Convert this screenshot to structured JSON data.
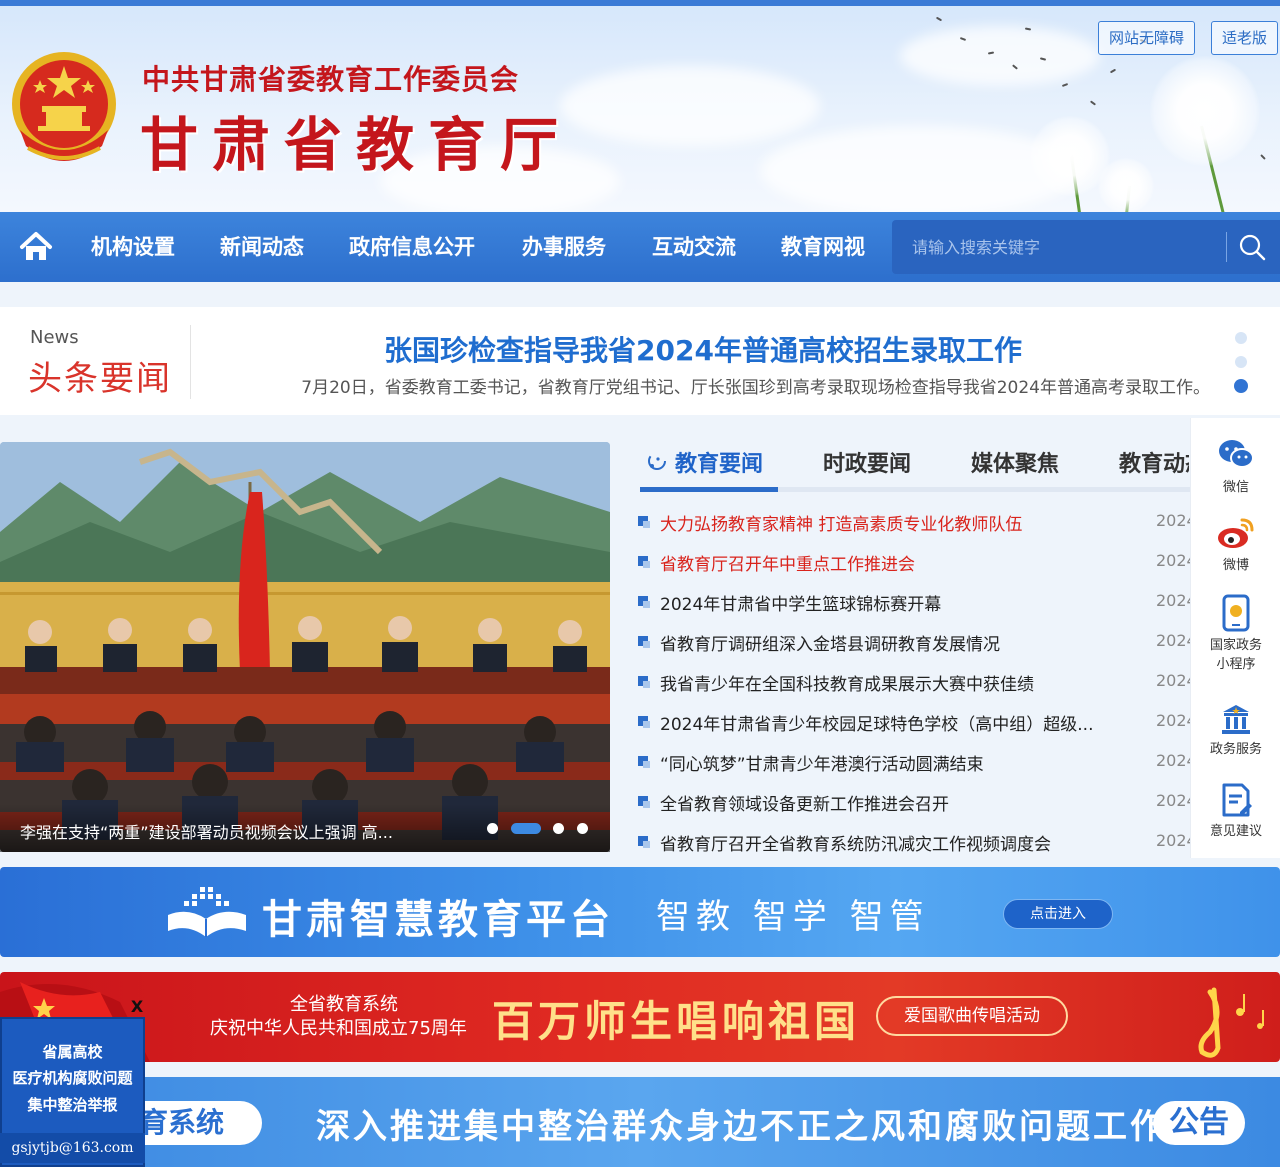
{
  "header": {
    "subtitle": "中共甘肃省委教育工作委员会",
    "title": "甘肃省教育厅",
    "accessibility_label": "网站无障碍",
    "elderly_label": "适老版"
  },
  "nav": {
    "items": [
      "机构设置",
      "新闻动态",
      "政府信息公开",
      "办事服务",
      "互动交流",
      "教育网视"
    ],
    "search_placeholder": "请输入搜索关键字"
  },
  "headline": {
    "label_en": "News",
    "label_cn": "头条要闻",
    "title": "张国珍检查指导我省2024年普通高校招生录取工作",
    "description": "7月20日，省委教育工委书记，省教育厅党组书记、厅长张国珍到高考录取现场检查指导我省2024年普通高考录取工作。"
  },
  "slider": {
    "caption": "李强在支持“两重”建设部署动员视频会议上强调 高..."
  },
  "news": {
    "tabs": [
      "教育要闻",
      "时政要闻",
      "媒体聚焦",
      "教育动态"
    ],
    "items": [
      {
        "title": "大力弘扬教育家精神 打造高素质专业化教师队伍",
        "date": "2024",
        "hot": true
      },
      {
        "title": "省教育厅召开年中重点工作推进会",
        "date": "2024",
        "hot": true
      },
      {
        "title": "2024年甘肃省中学生篮球锦标赛开幕",
        "date": "2024",
        "hot": false
      },
      {
        "title": "省教育厅调研组深入金塔县调研教育发展情况",
        "date": "2024",
        "hot": false
      },
      {
        "title": "我省青少年在全国科技教育成果展示大赛中获佳绩",
        "date": "2024",
        "hot": false
      },
      {
        "title": "2024年甘肃省青少年校园足球特色学校（高中组）超级...",
        "date": "2024",
        "hot": false
      },
      {
        "title": "“同心筑梦”甘肃青少年港澳行活动圆满结束",
        "date": "2024",
        "hot": false
      },
      {
        "title": "全省教育领域设备更新工作推进会召开",
        "date": "2024",
        "hot": false
      },
      {
        "title": "省教育厅召开全省教育系统防汛减灾工作视频调度会",
        "date": "2024",
        "hot": false
      }
    ]
  },
  "side_tools": {
    "wechat": "微信",
    "weibo": "微博",
    "miniapp_1": "国家政务",
    "miniapp_2": "小程序",
    "service": "政务服务",
    "feedback": "意见建议"
  },
  "banner_platform": {
    "title": "甘肃智慧教育平台",
    "sub": "智教 智学 智管",
    "button": "点击进入"
  },
  "banner_song": {
    "line1": "全省教育系统",
    "line2": "庆祝中华人民共和国成立75周年",
    "big": "百万师生唱响祖国",
    "pill": "爱国歌曲传唱活动"
  },
  "banner_anti": {
    "left": "育系统",
    "main": "深入推进集中整治群众身边不正之风和腐败问题工作",
    "tag": "公告"
  },
  "float_widget": {
    "close": "X",
    "line1": "省属高校",
    "line2": "医疗机构腐败问题",
    "line3": "集中整治举报",
    "email": "gsjytjb@163.com"
  },
  "colors": {
    "brand_blue": "#2d6fcd",
    "headline_red": "#d9342b",
    "hot_red": "#d9231c"
  }
}
